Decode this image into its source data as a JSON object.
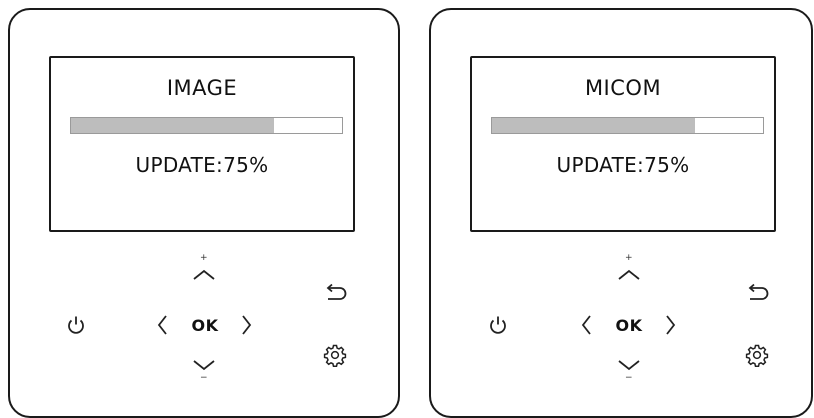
{
  "controllers": [
    {
      "screen_title": "IMAGE",
      "progress_fraction": 0.75,
      "update_label": "UPDATE:",
      "update_value": "75%",
      "ok_label": "OK",
      "plus_label": "+",
      "minus_label": "−"
    },
    {
      "screen_title": "MICOM",
      "progress_fraction": 0.75,
      "update_label": "UPDATE:",
      "update_value": "75%",
      "ok_label": "OK",
      "plus_label": "+",
      "minus_label": "−"
    }
  ],
  "icons": {
    "power": "power-icon",
    "up": "chevron-up-icon",
    "down": "chevron-down-icon",
    "left": "chevron-left-icon",
    "right": "chevron-right-icon",
    "back": "back-arrow-icon",
    "settings": "gear-icon"
  }
}
